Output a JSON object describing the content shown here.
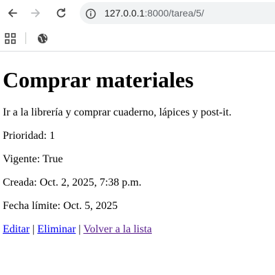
{
  "browser": {
    "url_host": "127.0.0.1",
    "url_path": ":8000/tarea/5/",
    "icons": {
      "back": "arrow-left",
      "forward": "arrow-right",
      "reload": "reload",
      "site_info": "info-circle",
      "apps": "apps-grid",
      "bookmark": "globe"
    },
    "colors": {
      "icon": "#474747",
      "icon_disabled": "#b8babc",
      "omnibox_bg": "#f1f3f4"
    }
  },
  "task": {
    "title": "Comprar materiales",
    "description": "Ir a la librería y comprar cuaderno, lápices y post-it.",
    "priority": "Prioridad: 1",
    "active": "Vigente: True",
    "created": "Creada: Oct. 2, 2025, 7:38 p.m.",
    "due_date": "Fecha límite: Oct. 5, 2025"
  },
  "actions": {
    "edit_label": "Editar",
    "delete_label": "Eliminar",
    "back_label": "Volver a la lista",
    "separator": "|",
    "link_color": "#0000ee",
    "visited_link_color": "#551a8b"
  }
}
